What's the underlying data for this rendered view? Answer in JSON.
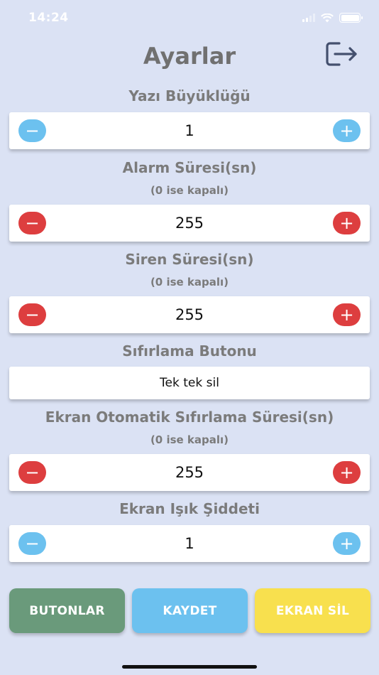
{
  "status_bar": {
    "time": "14:24"
  },
  "header": {
    "title": "Ayarlar",
    "logout_icon": "logout-icon"
  },
  "settings": {
    "font_size": {
      "label": "Yazı Büyüklüğü",
      "value": "1",
      "minus": "−",
      "plus": "+",
      "color": "#6cc1ef"
    },
    "alarm_duration": {
      "label": "Alarm Süresi(sn)",
      "sublabel": "(0 ise kapalı)",
      "value": "255",
      "minus": "−",
      "plus": "+",
      "color": "#dd3e3f"
    },
    "siren_duration": {
      "label": "Siren Süresi(sn)",
      "sublabel": "(0 ise kapalı)",
      "value": "255",
      "minus": "−",
      "plus": "+",
      "color": "#dd3e3f"
    },
    "reset_button": {
      "label": "Sıfırlama Butonu",
      "value": "Tek tek sil"
    },
    "screen_auto_reset": {
      "label": "Ekran Otomatik Sıfırlama Süresi(sn)",
      "sublabel": "(0 ise kapalı)",
      "value": "255",
      "minus": "−",
      "plus": "+",
      "color": "#dd3e3f"
    },
    "screen_brightness": {
      "label": "Ekran Işık Şiddeti",
      "value": "1",
      "minus": "−",
      "plus": "+",
      "color": "#6cc1ef"
    }
  },
  "actions": {
    "buttons": {
      "label": "BUTONLAR",
      "color": "#6a9a7b"
    },
    "save": {
      "label": "KAYDET",
      "color": "#6cc1ef"
    },
    "clear_screen": {
      "label": "EKRAN SİL",
      "color": "#f8e04e"
    }
  }
}
